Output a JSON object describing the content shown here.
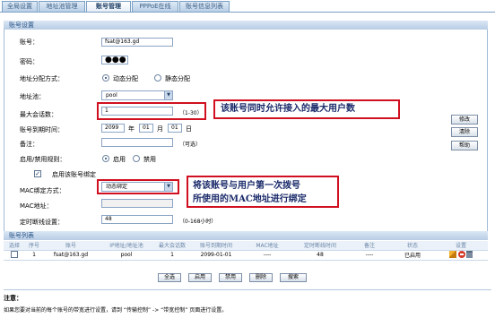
{
  "tabs": [
    {
      "label": "全局设置",
      "active": false
    },
    {
      "label": "地址池管理",
      "active": false
    },
    {
      "label": "账号管理",
      "active": true
    },
    {
      "label": "PPPoE在线",
      "active": false
    },
    {
      "label": "账号信息列表",
      "active": false
    }
  ],
  "account_section": {
    "title": "账号设置",
    "account_label": "账号：",
    "account_value": "fsat@163.gd",
    "password_label": "密码：",
    "password_value": "●●●",
    "addr_mode_label": "地址分配方式：",
    "addr_mode_dynamic": "动态分配",
    "addr_mode_static": "静态分配",
    "pool_label": "地址池：",
    "pool_value": "pool",
    "max_sessions_label": "最大会话数：",
    "max_sessions_value": "1",
    "max_sessions_hint": "（1-30）",
    "expire_label": "账号到期时间：",
    "expire_year": "2099",
    "expire_year_unit": "年",
    "expire_month": "01",
    "expire_month_unit": "月",
    "expire_day": "01",
    "expire_day_unit": "日",
    "note_label": "备注：",
    "note_value": "",
    "note_hint": "（可选）",
    "enable_rule_label": "启用/禁用规则：",
    "enable_label": "启用",
    "disable_label": "禁用",
    "bind_enable_label": "启用该账号绑定",
    "mac_bind_label": "MAC绑定方式：",
    "mac_bind_value": "动态绑定",
    "mac_addr_label": "MAC地址：",
    "mac_addr_value": "",
    "timed_disconnect_label": "定时断线设置：",
    "timed_disconnect_value": "48",
    "timed_disconnect_hint": "（0-168小时）"
  },
  "side_buttons": {
    "modify": "修改",
    "clear": "清除",
    "help": "帮助"
  },
  "callouts": {
    "max_users": "该账号同时允许接入的最大用户数",
    "mac_bind": "将该账号与用户第一次拨号\n所使用的MAC地址进行绑定"
  },
  "list_section": {
    "title": "账号列表",
    "columns": [
      "选择",
      "序号",
      "账号",
      "IP地址/地址池",
      "最大会话数",
      "账号到期时间",
      "MAC地址",
      "定时断线时间",
      "备注",
      "状态",
      "设置"
    ],
    "rows": [
      {
        "index": "1",
        "account": "fsat@163.gd",
        "pool": "pool",
        "max": "1",
        "expire": "2099-01-01",
        "mac": "----",
        "timed": "48",
        "note": "----",
        "status": "已启用"
      }
    ]
  },
  "bottom_buttons": {
    "select_all": "全选",
    "enable": "启用",
    "disable": "禁用",
    "delete": "删除",
    "search": "搜索"
  },
  "notes": {
    "title": "注意：",
    "text": "如果您要对当前的每个账号的带宽进行设置，请到 “传输控制” -> “带宽控制” 页面进行设置。"
  },
  "colors": {
    "accent_red": "#d01020",
    "header_blue": "#2a5587"
  }
}
